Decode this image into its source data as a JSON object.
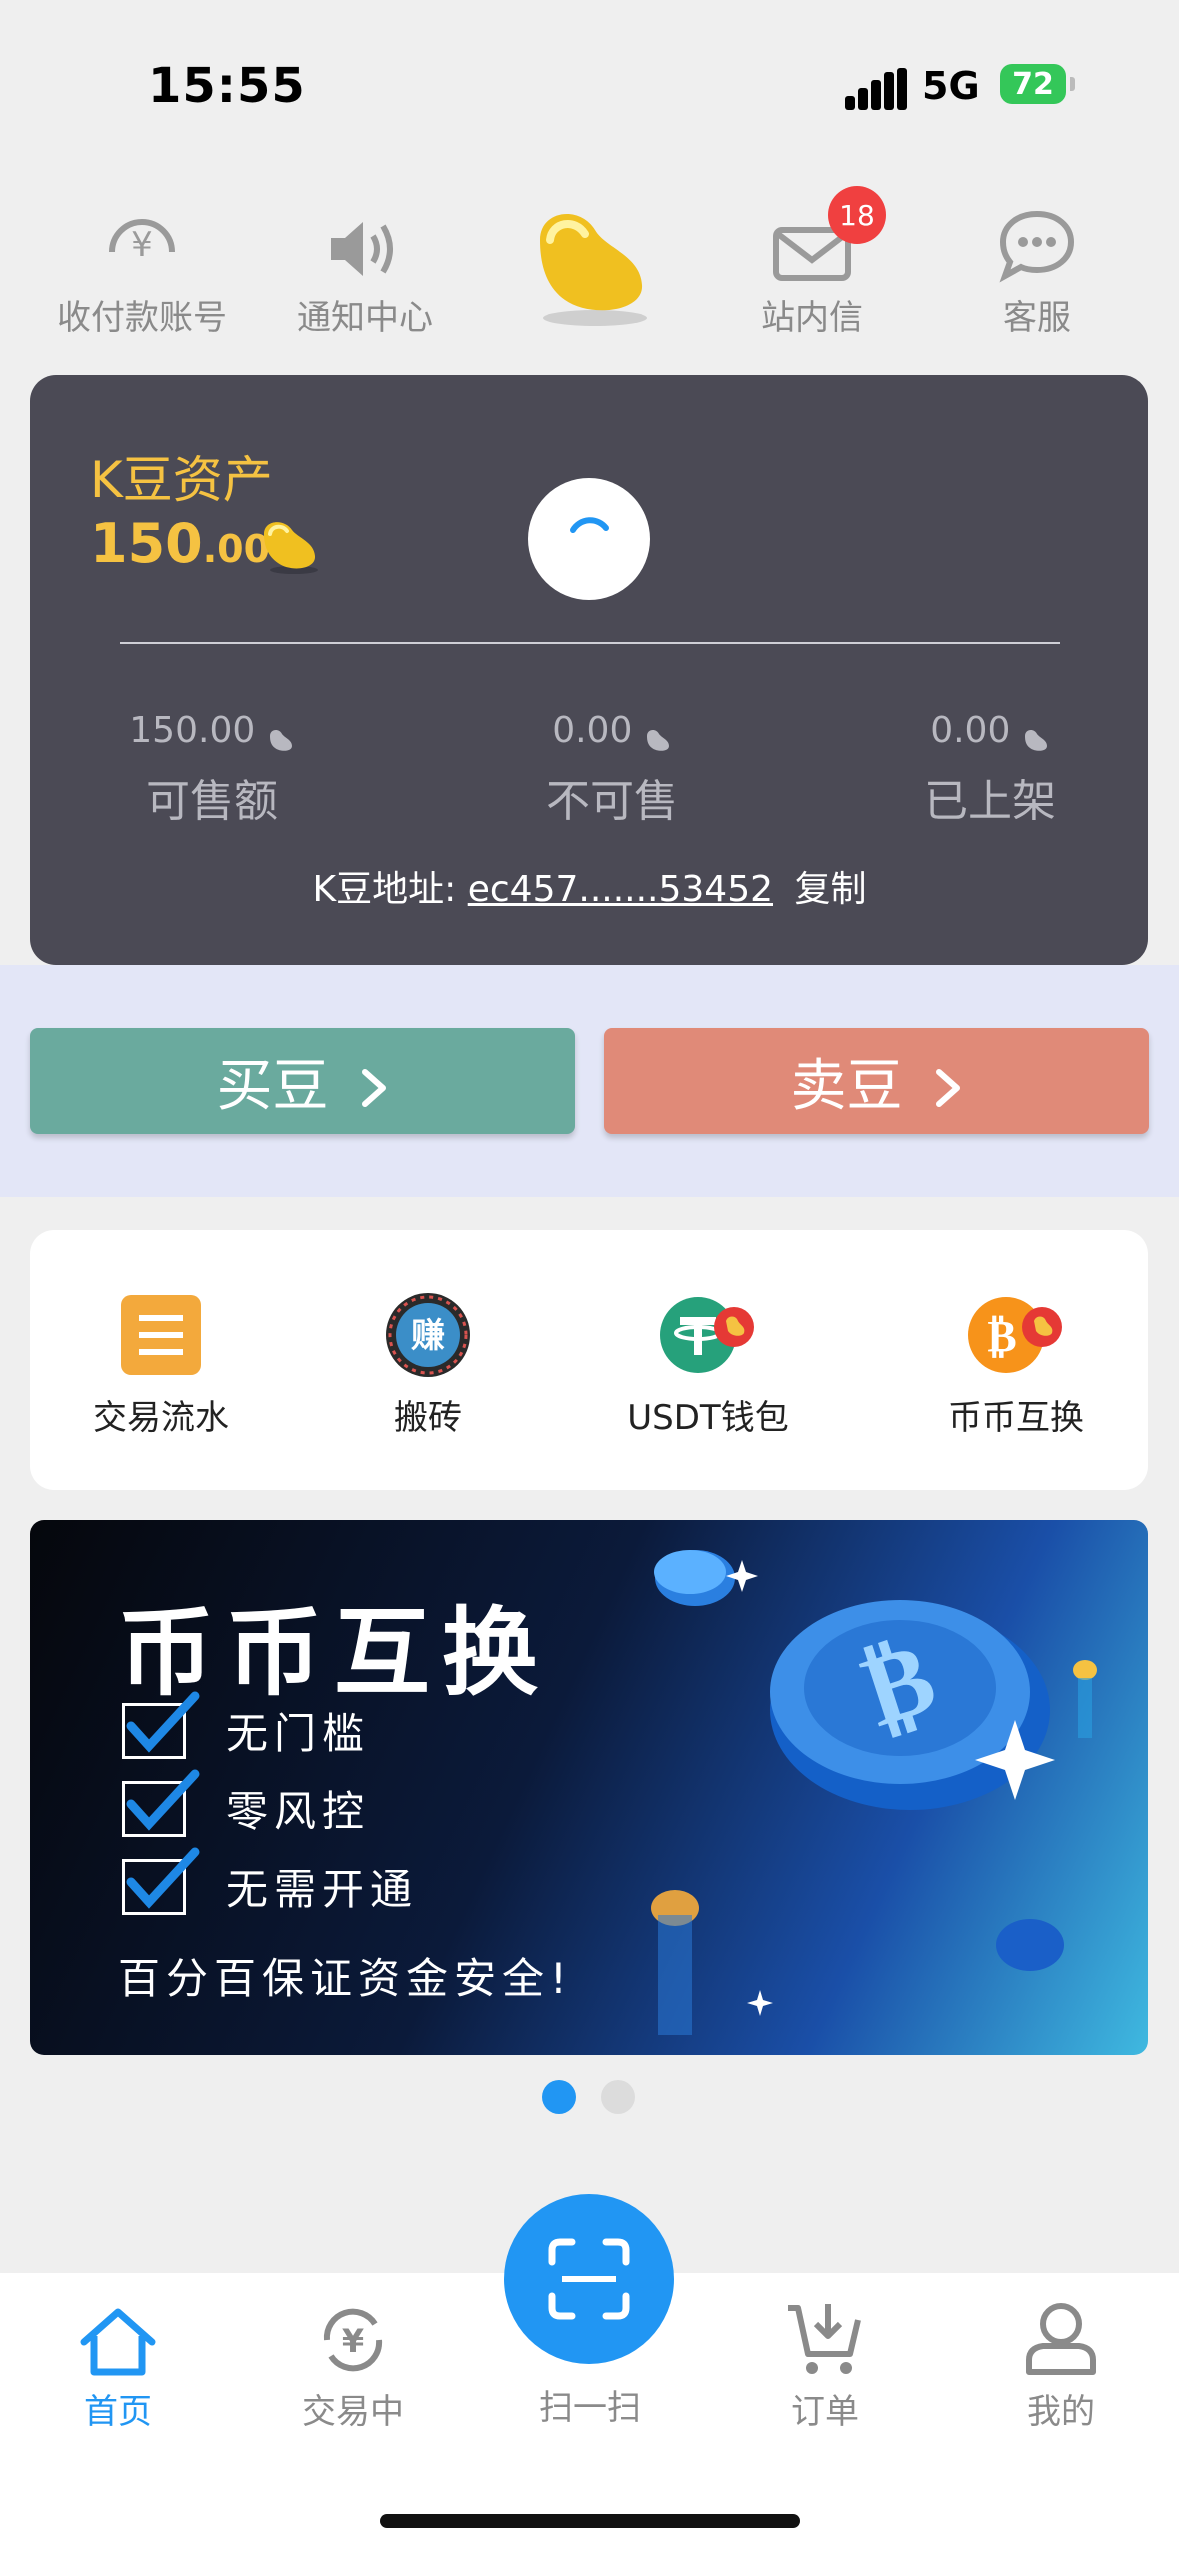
{
  "status_bar": {
    "time": "15:55",
    "network": "5G",
    "battery": "72"
  },
  "top_nav": {
    "items": [
      {
        "label": "收付款账号",
        "icon": "yuan-circle-icon"
      },
      {
        "label": "通知中心",
        "icon": "speaker-icon"
      },
      {
        "label": "",
        "icon": "golden-bean-icon"
      },
      {
        "label": "站内信",
        "icon": "mail-icon",
        "badge": "18"
      },
      {
        "label": "客服",
        "icon": "chat-bubble-icon"
      }
    ]
  },
  "asset_card": {
    "title": "K豆资产",
    "value_int": "150",
    "value_dec": ".00",
    "stats": [
      {
        "value": "150.00",
        "label": "可售额"
      },
      {
        "value": "0.00",
        "label": "不可售"
      },
      {
        "value": "0.00",
        "label": "已上架"
      }
    ],
    "address_label": "K豆地址:",
    "address_value": "ec457.......53452",
    "copy_label": "复制"
  },
  "actions": {
    "buy_label": "买豆",
    "sell_label": "卖豆"
  },
  "features": {
    "items": [
      {
        "label": "交易流水",
        "icon": "list-icon"
      },
      {
        "label": "搬砖",
        "icon": "earn-icon",
        "glyph": "赚"
      },
      {
        "label": "USDT钱包",
        "icon": "usdt-icon"
      },
      {
        "label": "币币互换",
        "icon": "bitcoin-exchange-icon"
      }
    ]
  },
  "banner": {
    "title": "币币互换",
    "points": [
      "无门槛",
      "零风控",
      "无需开通"
    ],
    "footer": "百分百保证资金安全!",
    "page_index": 1,
    "page_count": 2
  },
  "tab_bar": {
    "items": [
      {
        "label": "首页",
        "icon": "home-icon",
        "active": true
      },
      {
        "label": "交易中",
        "icon": "yuan-cycle-icon",
        "active": false
      },
      {
        "label": "扫一扫",
        "icon": "scan-icon",
        "active": false
      },
      {
        "label": "订单",
        "icon": "cart-icon",
        "active": false
      },
      {
        "label": "我的",
        "icon": "user-icon",
        "active": false
      }
    ]
  },
  "colors": {
    "accent": "#2196f3",
    "card_bg": "#4b4a55",
    "gold": "#f5c242",
    "buy": "#6aaa9e",
    "sell": "#e08a78"
  }
}
